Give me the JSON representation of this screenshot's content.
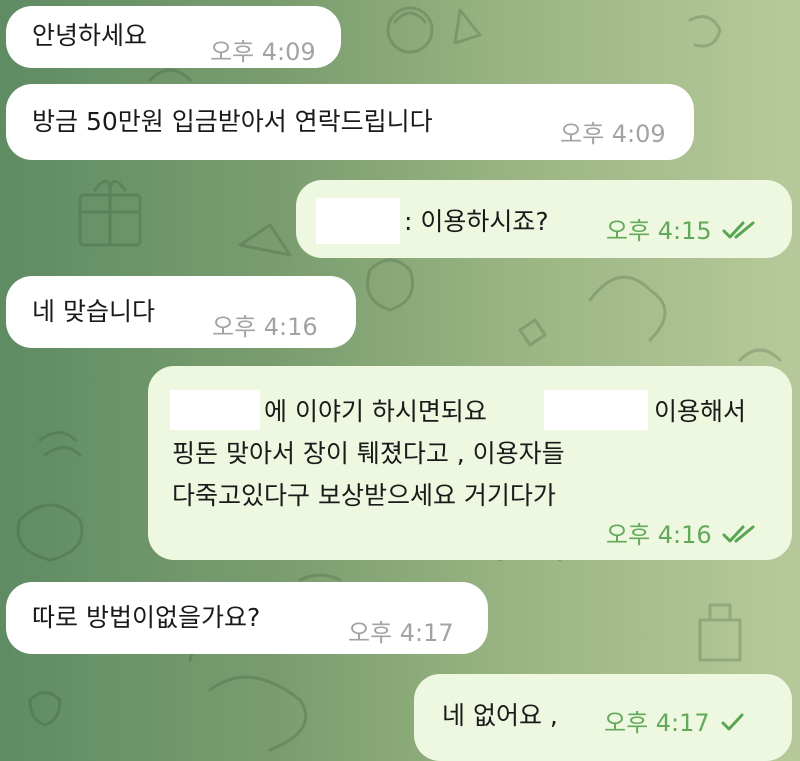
{
  "messages": [
    {
      "direction": "incoming",
      "text": "안녕하세요",
      "time": "오후 4:09"
    },
    {
      "direction": "incoming",
      "text": "방금 50만원 입금받아서 연락드립니다",
      "time": "오후 4:09"
    },
    {
      "direction": "outgoing",
      "text": ": 이용하시죠?",
      "time": "오후 4:15",
      "status": "read"
    },
    {
      "direction": "incoming",
      "text": "네 맞습니다",
      "time": "오후 4:16"
    },
    {
      "direction": "outgoing",
      "line1_a": "에 이야기 하시면되요",
      "line1_b": "이용해서",
      "line2": "핑돈 맞아서 장이 퉤졌다고 , 이용자들",
      "line3": "다죽고있다구 보상받으세요 거기다가",
      "time": "오후 4:16",
      "status": "read"
    },
    {
      "direction": "incoming",
      "text": "따로 방법이없을가요?",
      "time": "오후 4:17"
    },
    {
      "direction": "outgoing",
      "text": "네 없어요 ,",
      "time": "오후 4:17",
      "status": "sent"
    }
  ],
  "theme": {
    "incoming_bubble": "#ffffff",
    "outgoing_bubble": "#eef7df",
    "outgoing_time_color": "#63a95a",
    "incoming_time_color": "#a3a3a3",
    "check_color": "#58a552"
  },
  "icons": {
    "read": "double-check-icon",
    "sent": "single-check-icon"
  }
}
